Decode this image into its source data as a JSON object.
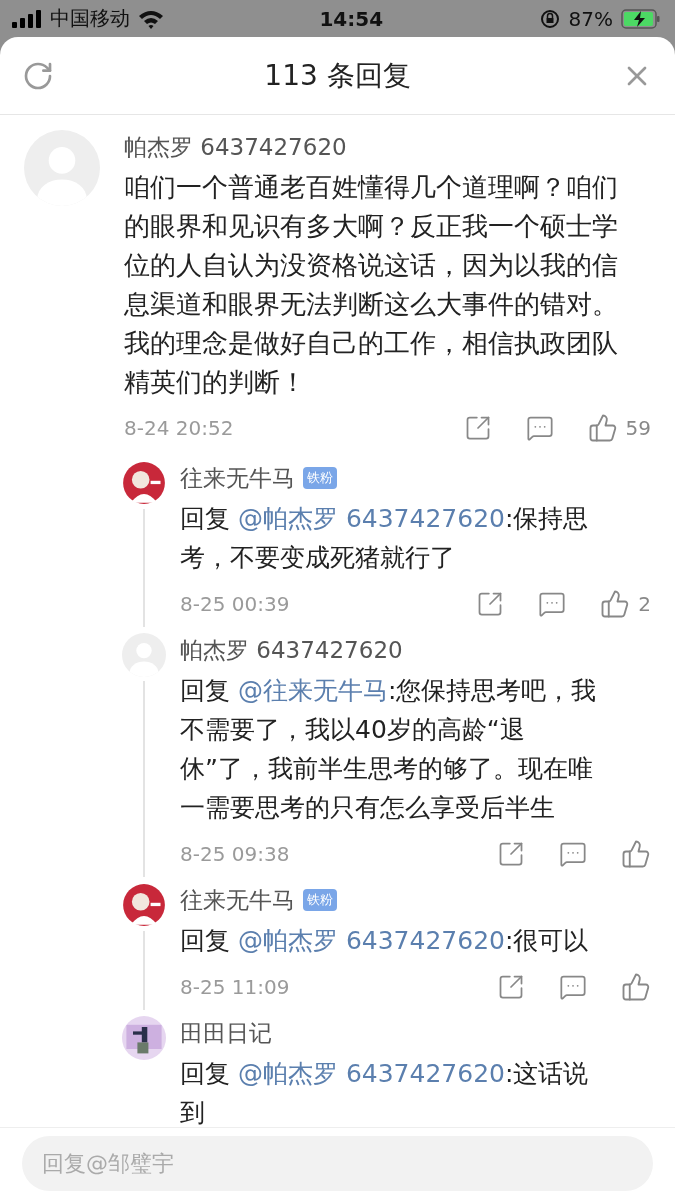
{
  "status_bar": {
    "carrier": "中国移动",
    "time": "14:54",
    "battery": "87%"
  },
  "header": {
    "title": "113 条回复"
  },
  "comment": {
    "author": "帕杰罗 6437427620",
    "text": "咱们一个普通老百姓懂得几个道理啊？咱们的眼界和见识有多大啊？反正我一个硕士学位的人自认为没资格说这话，因为以我的信息渠道和眼界无法判断这么大事件的错对。我的理念是做好自己的工作，相信执政团队精英们的判断！",
    "time": "8-24 20:52",
    "likes": "59"
  },
  "replies": [
    {
      "author": "往来无牛马",
      "badge": "铁粉",
      "prefix": "回复",
      "mention": "@帕杰罗 6437427620",
      "text": ":保持思考，不要变成死猪就行了",
      "time": "8-25 00:39",
      "likes": "2"
    },
    {
      "author": "帕杰罗 6437427620",
      "prefix": "回复",
      "mention": "@往来无牛马",
      "text": ":您保持思考吧，我不需要了，我以40岁的高龄“退休”了，我前半生思考的够了。现在唯一需要思考的只有怎么享受后半生",
      "time": "8-25 09:38"
    },
    {
      "author": "往来无牛马",
      "badge": "铁粉",
      "prefix": "回复",
      "mention": "@帕杰罗 6437427620",
      "text": ":很可以",
      "time": "8-25 11:09"
    },
    {
      "author": "田田日记",
      "prefix": "回复",
      "mention": "@帕杰罗 6437427620",
      "text": ":这话说到"
    }
  ],
  "reply_bar": {
    "placeholder": "回复@邹璧宇"
  }
}
